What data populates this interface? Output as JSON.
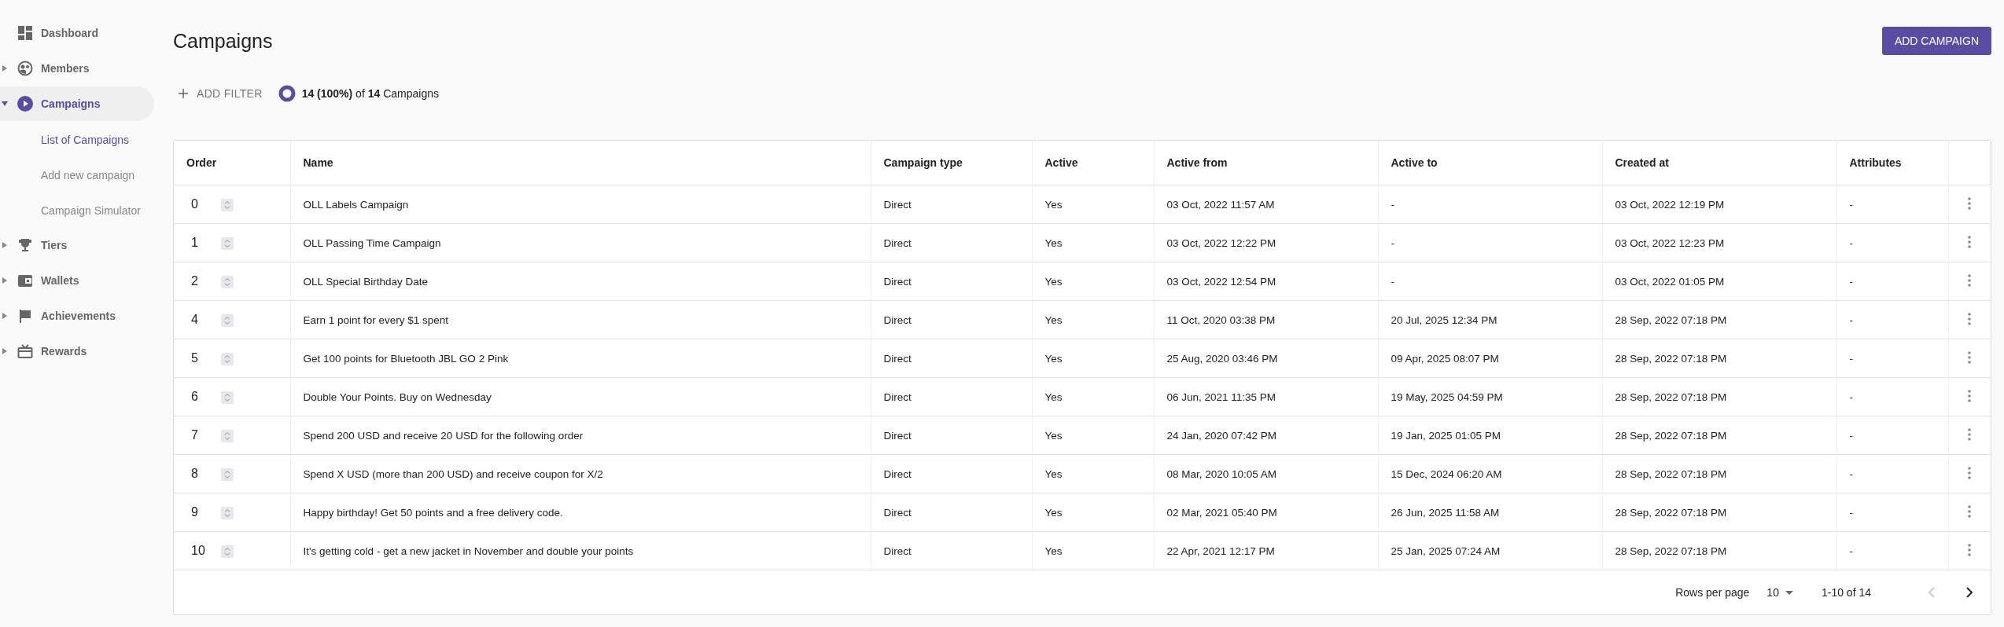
{
  "sidebar": {
    "items": [
      {
        "label": "Dashboard",
        "expandable": false,
        "selected": false
      },
      {
        "label": "Members",
        "expandable": true,
        "expanded": false,
        "selected": false
      },
      {
        "label": "Campaigns",
        "expandable": true,
        "expanded": true,
        "selected": true,
        "children": [
          {
            "label": "List of Campaigns",
            "selected": true
          },
          {
            "label": "Add new campaign",
            "selected": false
          },
          {
            "label": "Campaign Simulator",
            "selected": false
          }
        ]
      },
      {
        "label": "Tiers",
        "expandable": true,
        "expanded": false,
        "selected": false
      },
      {
        "label": "Wallets",
        "expandable": true,
        "expanded": false,
        "selected": false
      },
      {
        "label": "Achievements",
        "expandable": true,
        "expanded": false,
        "selected": false
      },
      {
        "label": "Rewards",
        "expandable": true,
        "expanded": false,
        "selected": false
      }
    ]
  },
  "page": {
    "title": "Campaigns",
    "add_button": "ADD CAMPAIGN",
    "add_filter": "ADD FILTER",
    "summary": "**14 (100%)** of **14** Campaigns"
  },
  "table": {
    "columns": [
      "Order",
      "Name",
      "Campaign type",
      "Active",
      "Active from",
      "Active to",
      "Created at",
      "Attributes"
    ],
    "rows": [
      {
        "order": "0",
        "name": "OLL Labels Campaign",
        "type": "Direct",
        "active": "Yes",
        "from": "03 Oct, 2022 11:57 AM",
        "to": "-",
        "created": "03 Oct, 2022 12:19 PM",
        "attributes": "-"
      },
      {
        "order": "1",
        "name": "OLL Passing Time Campaign",
        "type": "Direct",
        "active": "Yes",
        "from": "03 Oct, 2022 12:22 PM",
        "to": "-",
        "created": "03 Oct, 2022 12:23 PM",
        "attributes": "-"
      },
      {
        "order": "2",
        "name": "OLL Special Birthday Date",
        "type": "Direct",
        "active": "Yes",
        "from": "03 Oct, 2022 12:54 PM",
        "to": "-",
        "created": "03 Oct, 2022 01:05 PM",
        "attributes": "-"
      },
      {
        "order": "4",
        "name": "Earn 1 point for every $1 spent",
        "type": "Direct",
        "active": "Yes",
        "from": "11 Oct, 2020 03:38 PM",
        "to": "20 Jul, 2025 12:34 PM",
        "created": "28 Sep, 2022 07:18 PM",
        "attributes": "-"
      },
      {
        "order": "5",
        "name": "Get 100 points for Bluetooth JBL GO 2 Pink",
        "type": "Direct",
        "active": "Yes",
        "from": "25 Aug, 2020 03:46 PM",
        "to": "09 Apr, 2025 08:07 PM",
        "created": "28 Sep, 2022 07:18 PM",
        "attributes": "-"
      },
      {
        "order": "6",
        "name": "Double Your Points. Buy on Wednesday",
        "type": "Direct",
        "active": "Yes",
        "from": "06 Jun, 2021 11:35 PM",
        "to": "19 May, 2025 04:59 PM",
        "created": "28 Sep, 2022 07:18 PM",
        "attributes": "-"
      },
      {
        "order": "7",
        "name": "Spend 200 USD and receive 20 USD for the following order",
        "type": "Direct",
        "active": "Yes",
        "from": "24 Jan, 2020 07:42 PM",
        "to": "19 Jan, 2025 01:05 PM",
        "created": "28 Sep, 2022 07:18 PM",
        "attributes": "-"
      },
      {
        "order": "8",
        "name": "Spend X USD (more than 200 USD) and receive coupon for X/2",
        "type": "Direct",
        "active": "Yes",
        "from": "08 Mar, 2020 10:05 AM",
        "to": "15 Dec, 2024 06:20 AM",
        "created": "28 Sep, 2022 07:18 PM",
        "attributes": "-"
      },
      {
        "order": "9",
        "name": "Happy birthday! Get 50 points and a free delivery code.",
        "type": "Direct",
        "active": "Yes",
        "from": "02 Mar, 2021 05:40 PM",
        "to": "26 Jun, 2025 11:58 AM",
        "created": "28 Sep, 2022 07:18 PM",
        "attributes": "-"
      },
      {
        "order": "10",
        "name": "It's getting cold - get a new jacket in November and double your points",
        "type": "Direct",
        "active": "Yes",
        "from": "22 Apr, 2021 12:17 PM",
        "to": "25 Jan, 2025 07:24 AM",
        "created": "28 Sep, 2022 07:18 PM",
        "attributes": "-"
      }
    ]
  },
  "pagination": {
    "rows_per_page_label": "Rows per page",
    "rows_per_page": "10",
    "range": "1-10 of 14",
    "prev_disabled": true,
    "next_disabled": false
  }
}
